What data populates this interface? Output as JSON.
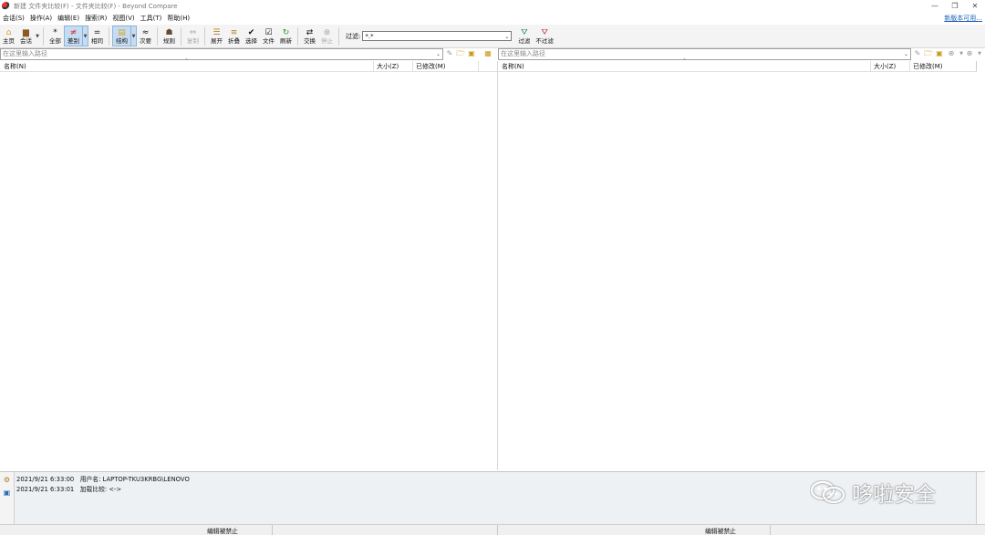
{
  "window": {
    "title": "新建 文件夹比较(F) - 文件夹比较(F) - Beyond Compare",
    "buttons": [
      "—",
      "❐",
      "✕"
    ]
  },
  "menu": {
    "items": [
      "会话(S)",
      "操作(A)",
      "编辑(E)",
      "搜索(R)",
      "视图(V)",
      "工具(T)",
      "帮助(H)"
    ],
    "update_link": "新版本可用..."
  },
  "toolbar": {
    "home": "主页",
    "sessions": "会话",
    "all": "全部",
    "diffs": "差别",
    "same": "相同",
    "structure": "结构",
    "minor": "次要",
    "rules": "规则",
    "copy": "复制",
    "expand": "展开",
    "collapse": "折叠",
    "select": "选择",
    "files": "文件",
    "refresh": "刷新",
    "swap": "交换",
    "stop": "停止",
    "filter_label": "过滤:",
    "filter_value": "*.*",
    "filters": "过滤",
    "no_filter": "不过滤"
  },
  "left_pane": {
    "path_placeholder": "在这里输入路径",
    "columns": {
      "name": "名称(N)",
      "size": "大小(Z)",
      "modified": "已修改(M)"
    },
    "status": "编辑被禁止"
  },
  "right_pane": {
    "path_placeholder": "在这里输入路径",
    "columns": {
      "name": "名称(N)",
      "size": "大小(Z)",
      "modified": "已修改(M)"
    },
    "status": "编辑被禁止"
  },
  "log": {
    "entries": [
      {
        "time": "2021/9/21 6:33:00",
        "text": "用户名: LAPTOP-TKU3KRBG\\LENOVO"
      },
      {
        "time": "2021/9/21 6:33:01",
        "text": "加载比较: <->"
      }
    ]
  },
  "watermark": {
    "text": "哆啦安全"
  },
  "colors": {
    "accent": "#c6dcf2",
    "link": "#1a5fb4",
    "folder": "#c89a1a"
  }
}
